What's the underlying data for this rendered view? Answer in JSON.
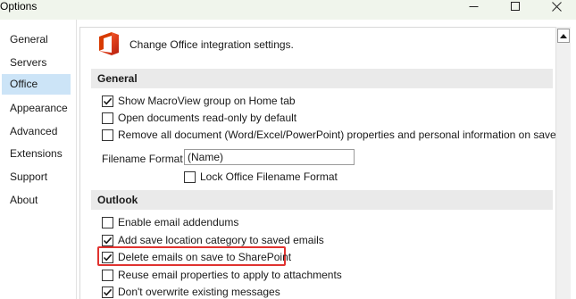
{
  "window": {
    "title": "Options"
  },
  "sidebar": {
    "items": [
      {
        "label": "General"
      },
      {
        "label": "Servers"
      },
      {
        "label": "Office",
        "active": true
      },
      {
        "label": "Appearance"
      },
      {
        "label": "Advanced"
      },
      {
        "label": "Extensions"
      },
      {
        "label": "Support"
      },
      {
        "label": "About"
      }
    ]
  },
  "main": {
    "header_icon": "office-logo-icon",
    "header_text": "Change Office integration settings.",
    "sections": {
      "general": {
        "title": "General",
        "options": [
          {
            "label": "Show MacroView group on Home tab",
            "checked": true
          },
          {
            "label": "Open documents read-only by default",
            "checked": false
          },
          {
            "label": "Remove all document (Word/Excel/PowerPoint) properties and personal information on save",
            "checked": false
          }
        ],
        "filename_format": {
          "label": "Filename Format",
          "value": "(Name)"
        },
        "lock_option": {
          "label": "Lock Office Filename Format",
          "checked": false
        }
      },
      "outlook": {
        "title": "Outlook",
        "options": [
          {
            "label": "Enable email addendums",
            "checked": false
          },
          {
            "label": "Add save location category to saved emails",
            "checked": true
          },
          {
            "label": "Delete emails on save to SharePoint",
            "checked": true,
            "highlighted": true
          },
          {
            "label": "Reuse email properties to apply to attachments",
            "checked": false
          },
          {
            "label": "Don't overwrite existing messages",
            "checked": true
          }
        ]
      }
    }
  },
  "colors": {
    "active_nav_bg": "#cce4f7",
    "section_bg": "#eaeaea",
    "highlight_border": "#e0322f",
    "titlebar_bg": "#f0f5ec"
  }
}
